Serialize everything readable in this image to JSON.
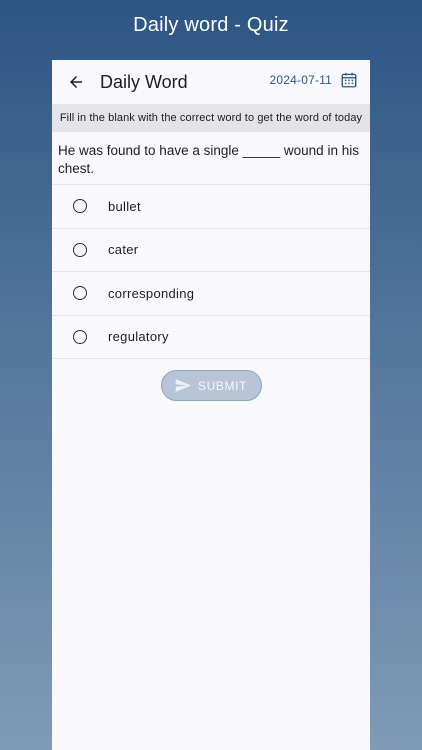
{
  "screen": {
    "title": "Daily word - Quiz"
  },
  "appbar": {
    "back_icon": "arrow-left-icon",
    "title": "Daily Word",
    "date": "2024-07-11",
    "calendar_icon": "calendar-icon"
  },
  "quiz": {
    "instruction": "Fill in the blank with the correct word to get the word of today",
    "question": "He was found to have a single _____ wound in his chest.",
    "options": [
      {
        "label": "bullet"
      },
      {
        "label": "cater"
      },
      {
        "label": "corresponding"
      },
      {
        "label": "regulatory"
      }
    ]
  },
  "submit": {
    "label": "SUBMIT",
    "icon": "send-icon",
    "enabled": false
  },
  "colors": {
    "accent": "#2d5583",
    "disabled_button": "#b7c5d7",
    "card_background": "#f9f9fd",
    "instruction_background": "#e3e3e8"
  }
}
